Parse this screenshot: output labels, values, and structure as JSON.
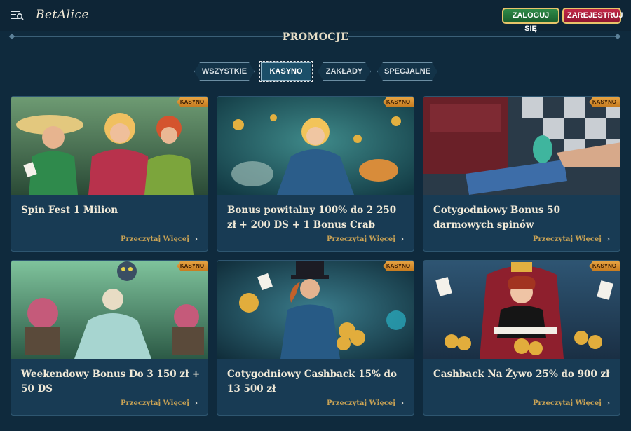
{
  "header": {
    "logo_text": "BetAlice",
    "login_label": "ZALOGUJ SIĘ",
    "register_label": "ZAREJESTRUJ",
    "menu_icon": "menu-icon"
  },
  "page": {
    "title": "PROMOCJE"
  },
  "tabs": [
    {
      "label": "WSZYSTKIE",
      "active": false
    },
    {
      "label": "KASYNO",
      "active": true
    },
    {
      "label": "ZAKŁADY",
      "active": false
    },
    {
      "label": "SPECJALNE",
      "active": false
    }
  ],
  "promos": [
    {
      "badge": "KASYNO",
      "title": "Spin Fest 1 Milion",
      "cta": "Przeczytaj Więcej"
    },
    {
      "badge": "KASYNO",
      "title": "Bonus powitalny 100% do 2 250 zł + 200 DS + 1 Bonus Crab",
      "cta": "Przeczytaj Więcej"
    },
    {
      "badge": "KASYNO",
      "title": "Cotygodniowy Bonus 50 darmowych spinów",
      "cta": "Przeczytaj Więcej"
    },
    {
      "badge": "KASYNO",
      "title": "Weekendowy Bonus Do 3 150 zł + 50 DS",
      "cta": "Przeczytaj Więcej"
    },
    {
      "badge": "KASYNO",
      "title": "Cotygodniowy Cashback 15% do 13 500 zł",
      "cta": "Przeczytaj Więcej"
    },
    {
      "badge": "KASYNO",
      "title": "Cashback Na Żywo 25% do 900 zł",
      "cta": "Przeczytaj Więcej"
    }
  ],
  "colors": {
    "background": "#0f2a3d",
    "card": "#183b54",
    "login": "#2f8a48",
    "register": "#c22647",
    "badge": "#e8a544",
    "cta": "#c8a255"
  }
}
